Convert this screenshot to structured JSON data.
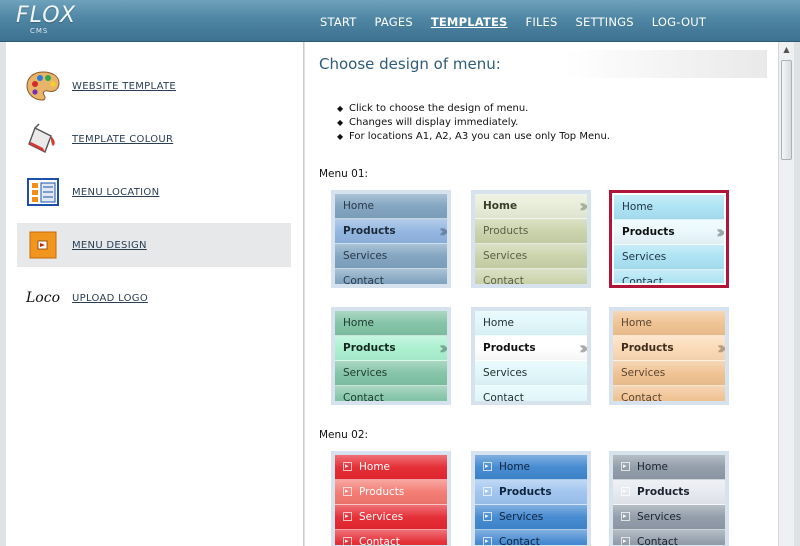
{
  "app": {
    "logo_text": "FLOX",
    "logo_sub": "CMS"
  },
  "nav": [
    {
      "label": "START",
      "active": false
    },
    {
      "label": "PAGES",
      "active": false
    },
    {
      "label": "TEMPLATES",
      "active": true
    },
    {
      "label": "FILES",
      "active": false
    },
    {
      "label": "SETTINGS",
      "active": false
    },
    {
      "label": "LOG-OUT",
      "active": false
    }
  ],
  "sidebar": {
    "items": [
      {
        "label": "WEBSITE TEMPLATE",
        "icon": "palette-icon",
        "active": false
      },
      {
        "label": "TEMPLATE COLOUR",
        "icon": "paint-bucket-icon",
        "active": false
      },
      {
        "label": "MENU LOCATION",
        "icon": "layout-icon",
        "active": false
      },
      {
        "label": "MENU DESIGN",
        "icon": "menu-design-icon",
        "active": true
      },
      {
        "label": "UPLOAD LOGO",
        "icon": "logo-icon",
        "icon_text": "Loco",
        "active": false
      }
    ]
  },
  "main": {
    "title": "Choose design of menu:",
    "instructions": [
      "Click to choose the design of menu.",
      "Changes will display immediately.",
      "For locations A1, A2, A3 you can use only Top Menu."
    ],
    "sections": [
      {
        "label": "Menu 01:",
        "samples": [
          {
            "style": "blue-gloss",
            "selected": false,
            "items": [
              "Home",
              "Products",
              "Services",
              "Contact"
            ],
            "bold_index": 1,
            "colors": [
              "#7ea2bf",
              "#8fb3df",
              "#7ea2bf",
              "#7ea2bf"
            ],
            "text_color": "#2b3a4a",
            "active_text": "#1c2a3a"
          },
          {
            "style": "olive-gloss",
            "selected": false,
            "items": [
              "Home",
              "Products",
              "Services",
              "Contact"
            ],
            "bold_index": 0,
            "colors": [
              "#e7ecd7",
              "#c9d2a9",
              "#c9d2a9",
              "#c9d2a9"
            ],
            "text_color": "#5a5f4a",
            "active_text": "#3a3f2a"
          },
          {
            "style": "cyan-gloss",
            "selected": true,
            "items": [
              "Home",
              "Products",
              "Services",
              "Contact"
            ],
            "bold_index": 1,
            "colors": [
              "#a9e2f3",
              "#e9f8fd",
              "#a9e2f3",
              "#a9e2f3"
            ],
            "text_color": "#1f3340",
            "active_text": "#111111"
          },
          {
            "style": "green-gloss",
            "selected": false,
            "items": [
              "Home",
              "Products",
              "Services",
              "Contact"
            ],
            "bold_index": 1,
            "colors": [
              "#7fc2a4",
              "#a9f0cf",
              "#7fc2a4",
              "#7fc2a4"
            ],
            "text_color": "#1f3a2e",
            "active_text": "#13271e"
          },
          {
            "style": "white-cyan",
            "selected": false,
            "items": [
              "Home",
              "Products",
              "Services",
              "Contact"
            ],
            "bold_index": 1,
            "colors": [
              "#dff7fb",
              "#ffffff",
              "#dff7fb",
              "#dff7fb"
            ],
            "text_color": "#1e2e33",
            "active_text": "#111111"
          },
          {
            "style": "orange-gloss",
            "selected": false,
            "items": [
              "Home",
              "Products",
              "Services",
              "Contact"
            ],
            "bold_index": 1,
            "colors": [
              "#f0c190",
              "#fbd9b5",
              "#f0c190",
              "#f0c190"
            ],
            "text_color": "#5b4632",
            "active_text": "#3d2d1e"
          }
        ]
      },
      {
        "label": "Menu 02:",
        "samples": [
          {
            "style": "red-icon",
            "selected": false,
            "items": [
              "Home",
              "Products",
              "Services",
              "Contact"
            ],
            "bold_index": -1,
            "colors": [
              "#e5262e",
              "#f3786e",
              "#e5262e",
              "#e5262e"
            ],
            "text_color": "#ffffff",
            "active_text": "#ffffff",
            "has_icon": true
          },
          {
            "style": "blue-icon",
            "selected": false,
            "items": [
              "Home",
              "Products",
              "Services",
              "Contact"
            ],
            "bold_index": 1,
            "colors": [
              "#3f86cf",
              "#9dc3ee",
              "#3f86cf",
              "#3f86cf"
            ],
            "text_color": "#0e2540",
            "active_text": "#0e2540",
            "has_icon": true
          },
          {
            "style": "grey-icon",
            "selected": false,
            "items": [
              "Home",
              "Products",
              "Services",
              "Contact"
            ],
            "bold_index": 1,
            "colors": [
              "#8f9aa8",
              "#e6e9ef",
              "#8f9aa8",
              "#8f9aa8"
            ],
            "text_color": "#1b2330",
            "active_text": "#1b2330",
            "has_icon": true
          }
        ]
      }
    ]
  },
  "colors": {
    "header": "#4f86a3",
    "selected_border": "#b0163a",
    "title": "#2f5c78"
  }
}
